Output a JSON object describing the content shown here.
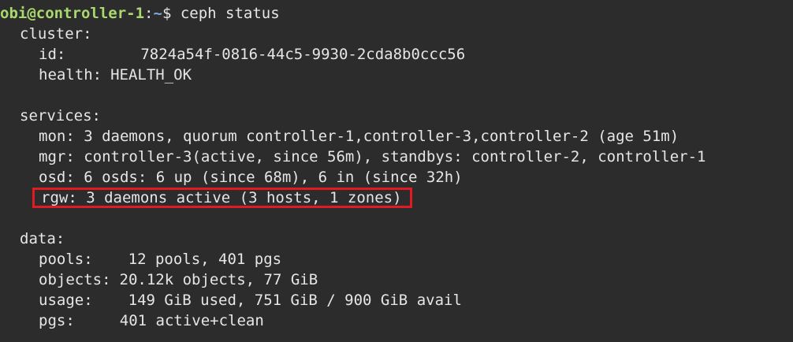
{
  "prompt": {
    "user_host": "obi@controller-1",
    "separator": ":",
    "path": "~",
    "symbol": "$",
    "command": " ceph status"
  },
  "cluster": {
    "heading": "cluster:",
    "id_label": "id:",
    "id_value": "7824a54f-0816-44c5-9930-2cda8b0ccc56",
    "health_label": "health:",
    "health_value": "HEALTH_OK"
  },
  "services": {
    "heading": "services:",
    "mon": "mon: 3 daemons, quorum controller-1,controller-3,controller-2 (age 51m)",
    "mgr": "mgr: controller-3(active, since 56m), standbys: controller-2, controller-1",
    "osd": "osd: 6 osds: 6 up (since 68m), 6 in (since 32h)",
    "rgw": "rgw: 3 daemons active (3 hosts, 1 zones)"
  },
  "data": {
    "heading": "data:",
    "pools_label": "pools:",
    "pools_value": "12 pools, 401 pgs",
    "objects_label": "objects:",
    "objects_value": "20.12k objects, 77 GiB",
    "usage_label": "usage:",
    "usage_value": "149 GiB used, 751 GiB / 900 GiB avail",
    "pgs_label": "pgs:",
    "pgs_value": "401 active+clean"
  },
  "colors": {
    "background": "#2c2c2c",
    "text": "#e6e6e6",
    "prompt_user": "#a9d86e",
    "prompt_path": "#7fa7d9",
    "highlight_box": "#e01b24"
  }
}
